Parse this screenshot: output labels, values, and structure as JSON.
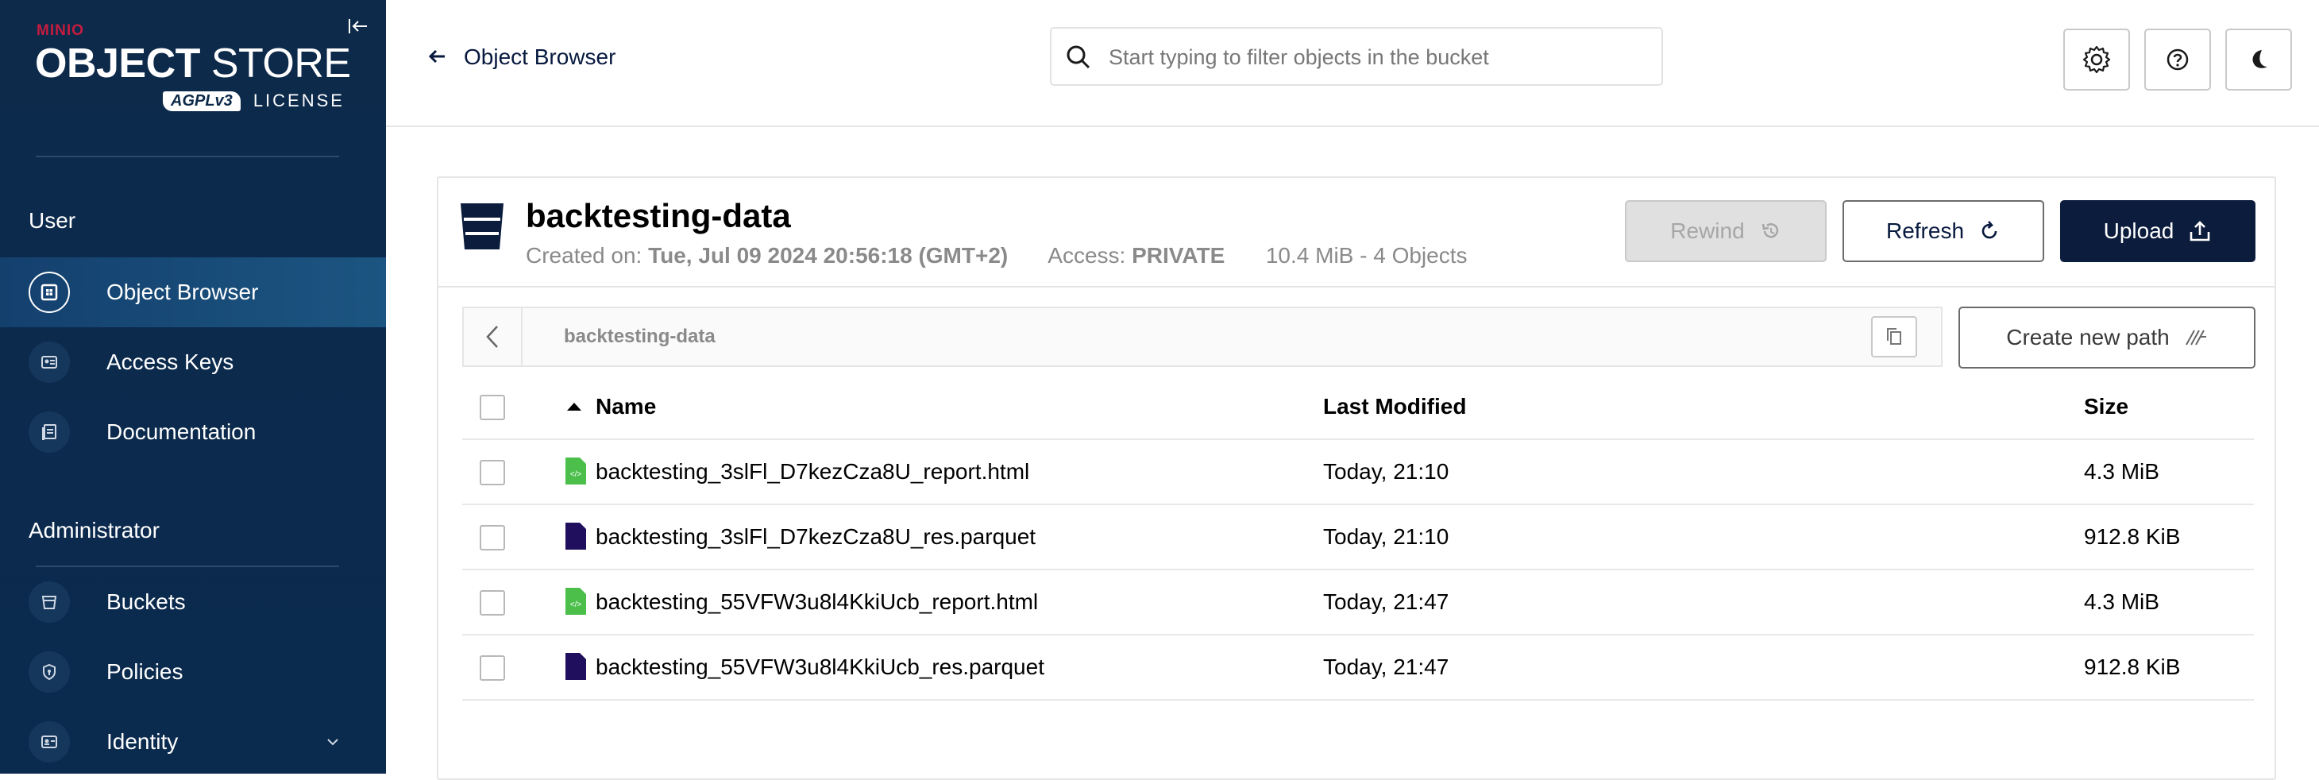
{
  "brand": {
    "minio": "MINIO",
    "title_bold": "OBJECT",
    "title_light": " STORE",
    "agpl": "AGPLv3",
    "license": "LICENSE"
  },
  "sidebar": {
    "sections": {
      "user": "User",
      "administrator": "Administrator"
    },
    "items": [
      {
        "label": "Object Browser",
        "icon": "object-browser-icon",
        "active": true
      },
      {
        "label": "Access Keys",
        "icon": "access-keys-icon",
        "active": false
      },
      {
        "label": "Documentation",
        "icon": "documentation-icon",
        "active": false
      },
      {
        "label": "Buckets",
        "icon": "buckets-icon",
        "active": false
      },
      {
        "label": "Policies",
        "icon": "policies-icon",
        "active": false
      },
      {
        "label": "Identity",
        "icon": "identity-icon",
        "active": false
      }
    ]
  },
  "header": {
    "back_label": "Object Browser",
    "search_placeholder": "Start typing to filter objects in the bucket",
    "search_value": ""
  },
  "bucket": {
    "name": "backtesting-data",
    "created_label": "Created on:",
    "created_value": "Tue, Jul 09 2024 20:56:18 (GMT+2)",
    "access_label": "Access:",
    "access_value": "PRIVATE",
    "summary": "10.4 MiB - 4 Objects"
  },
  "actions": {
    "rewind": "Rewind",
    "refresh": "Refresh",
    "upload": "Upload",
    "create_path": "Create new path"
  },
  "path": {
    "current": "backtesting-data"
  },
  "table": {
    "columns": {
      "name": "Name",
      "modified": "Last Modified",
      "size": "Size"
    },
    "sort": "name-ascending",
    "rows": [
      {
        "name": "backtesting_3slFl_D7kezCza8U_report.html",
        "modified": "Today, 21:10",
        "size": "4.3 MiB",
        "type": "html"
      },
      {
        "name": "backtesting_3slFl_D7kezCza8U_res.parquet",
        "modified": "Today, 21:10",
        "size": "912.8 KiB",
        "type": "file"
      },
      {
        "name": "backtesting_55VFW3u8l4KkiUcb_report.html",
        "modified": "Today, 21:47",
        "size": "4.3 MiB",
        "type": "html"
      },
      {
        "name": "backtesting_55VFW3u8l4KkiUcb_res.parquet",
        "modified": "Today, 21:47",
        "size": "912.8 KiB",
        "type": "file"
      }
    ]
  },
  "colors": {
    "sidebar_bg": "#0d2a4a",
    "accent_dark": "#0c1c3d",
    "brand_red": "#c51c3f",
    "html_file": "#4cbf4b",
    "generic_file": "#1f0f5c"
  }
}
